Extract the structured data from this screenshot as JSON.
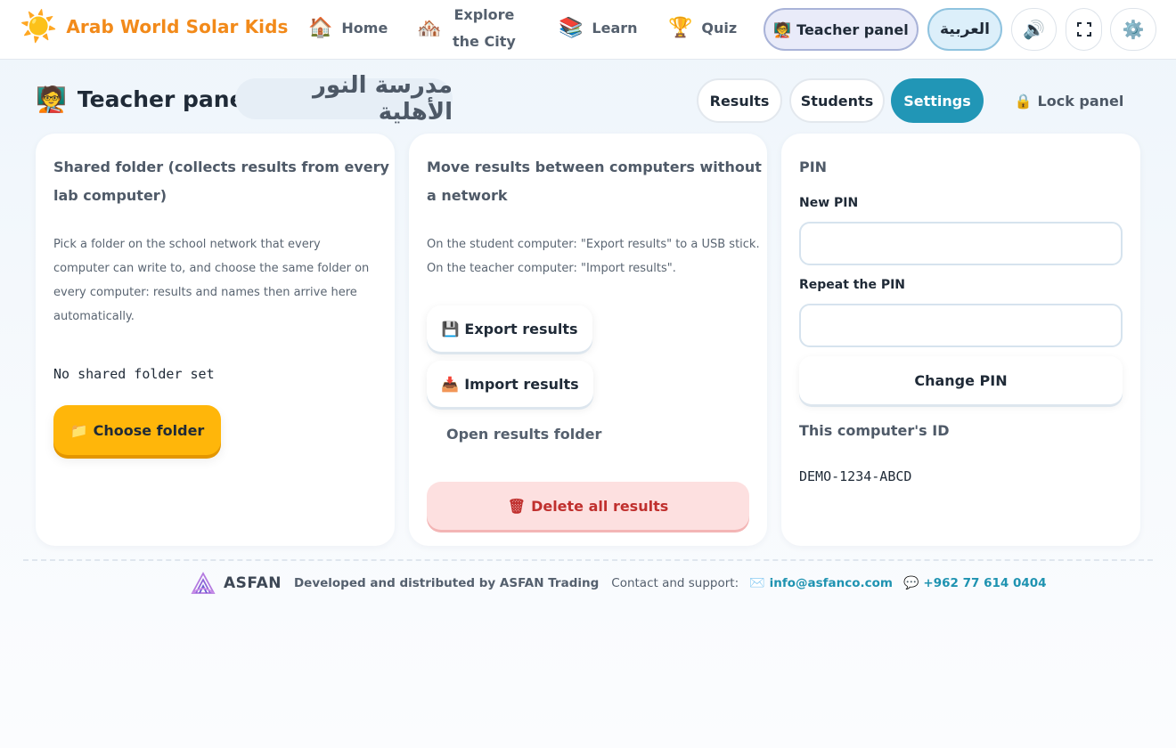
{
  "app": {
    "brand_name": "Arab World Solar Kids"
  },
  "nav": {
    "home": "Home",
    "explore_line1": "Explore",
    "explore_line2": "the City",
    "learn": "Learn",
    "quiz": "Quiz",
    "teacher_panel": "Teacher panel",
    "language": "العربية"
  },
  "icons": {
    "sun": "☀️",
    "home": "🏠",
    "city": "🏘️",
    "books": "📚",
    "trophy": "🏆",
    "teacher": "🧑‍🏫",
    "sound": "🔊",
    "fullscreen": "⛶",
    "gear": "⚙️",
    "lock": "🔒",
    "folder": "📁",
    "floppy": "💾",
    "inbox": "📥",
    "trash": "🗑",
    "mail": "✉️",
    "chat": "💬"
  },
  "panel": {
    "title": "Teacher panel",
    "school_name": "مدرسة النور الأهلية",
    "tabs": {
      "results": "Results",
      "students": "Students",
      "settings": "Settings"
    },
    "lock_label": "Lock panel",
    "active_tab": "settings"
  },
  "shared_folder": {
    "heading_line1": "Shared folder (collects results from every",
    "heading_line2": "lab computer)",
    "desc_line1": "Pick a folder on the school network that every",
    "desc_line2": "computer can write to, and choose the same folder on",
    "desc_line3": "every computer: results and names then arrive here",
    "desc_line4": "automatically.",
    "status": "No shared folder set",
    "choose_button": "Choose folder"
  },
  "transfer": {
    "heading_line1": "Move results between computers without",
    "heading_line2": "a network",
    "desc_line1": "On the student computer: \"Export results\" to a USB stick.",
    "desc_line2": "On the teacher computer: \"Import results\".",
    "export_button": "Export results",
    "import_button": "Import results",
    "open_folder": "Open results folder",
    "delete_button": "Delete all results"
  },
  "pin": {
    "heading": "PIN",
    "new_label": "New PIN",
    "new_value": "",
    "repeat_label": "Repeat the PIN",
    "repeat_value": "",
    "change_button": "Change PIN",
    "computer_id_heading": "This computer's ID",
    "computer_id": "DEMO-1234-ABCD"
  },
  "footer": {
    "logo_text": "ASFAN",
    "developed_by": "Developed and distributed by ASFAN Trading",
    "contact_label": "Contact and support:",
    "email": "info@asfanco.com",
    "phone": "+962 77 614 0404"
  },
  "colors": {
    "brand_orange": "#f28a1a",
    "accent_teal": "#2196b6",
    "button_yellow": "#ffb60a",
    "danger_red": "#c0302e",
    "danger_bg": "#fde0e0",
    "link_teal": "#1f93b1"
  }
}
